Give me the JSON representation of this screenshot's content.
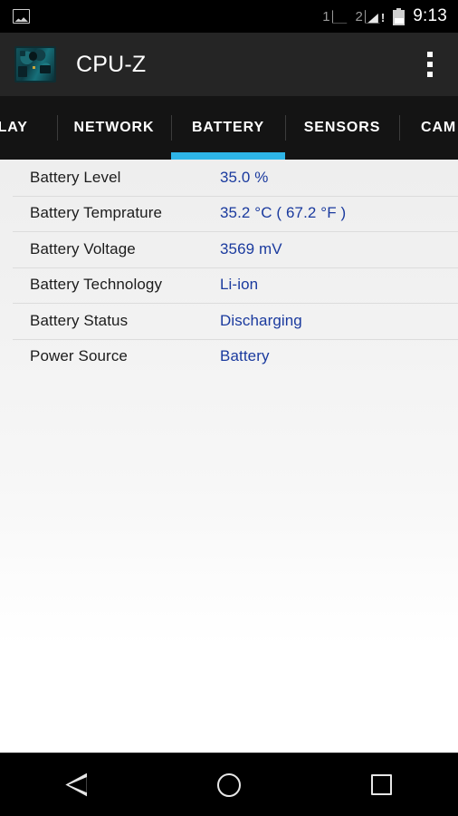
{
  "status_bar": {
    "notification_icon": "image-icon",
    "sim1_label": "1",
    "sim1_signal_icon": "signal-empty-icon",
    "sim2_label": "2",
    "sim2_signal_icon": "signal-partial-alert-icon",
    "sim2_alert": "!",
    "battery_icon": "battery-icon",
    "time": "9:13"
  },
  "app_bar": {
    "logo_icon": "cpuz-circuitboard-logo",
    "title": "CPU-Z",
    "overflow_icon": "more-vert-icon"
  },
  "tabs": [
    {
      "label": "PLAY",
      "active": false
    },
    {
      "label": "NETWORK",
      "active": false
    },
    {
      "label": "BATTERY",
      "active": true
    },
    {
      "label": "SENSORS",
      "active": false
    },
    {
      "label": "CAM",
      "active": false
    }
  ],
  "battery": {
    "rows": [
      {
        "label": "Battery Level",
        "value": "35.0 %"
      },
      {
        "label": "Battery Temprature",
        "value": "35.2 °C   ( 67.2 °F )"
      },
      {
        "label": "Battery Voltage",
        "value": "3569 mV"
      },
      {
        "label": "Battery Technology",
        "value": "Li-ion"
      },
      {
        "label": "Battery Status",
        "value": "Discharging"
      },
      {
        "label": "Power Source",
        "value": "Battery"
      }
    ]
  },
  "nav_bar": {
    "back_icon": "back-triangle-icon",
    "home_icon": "home-circle-icon",
    "recents_icon": "recents-square-icon"
  },
  "colors": {
    "accent": "#2eb4e6",
    "value_text": "#1a3a9e",
    "app_bar_bg": "#252525",
    "tab_bar_bg": "#141414",
    "status_bar_bg": "#000000"
  }
}
